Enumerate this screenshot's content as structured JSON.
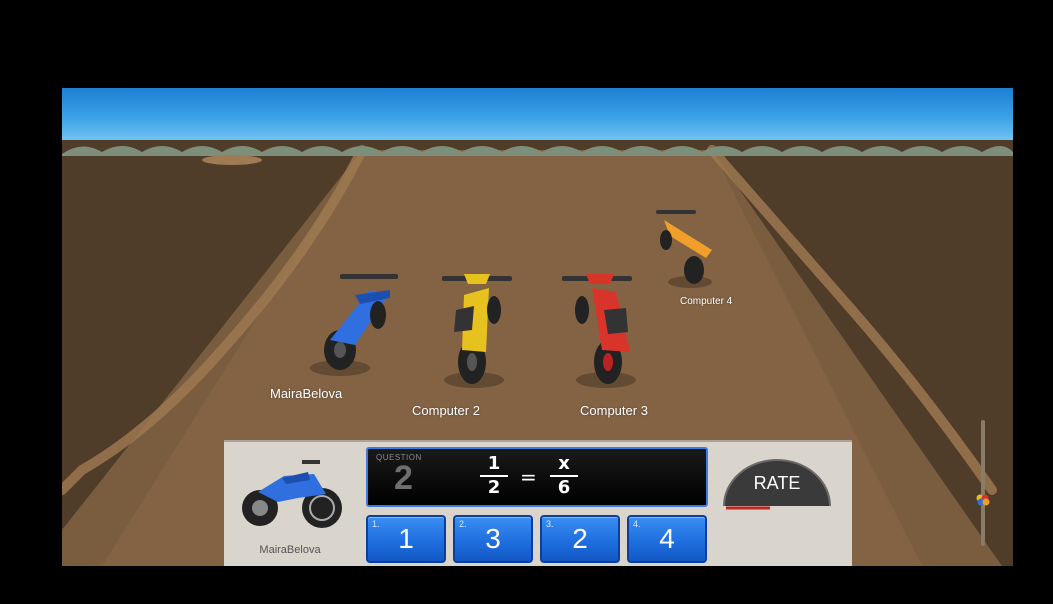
{
  "racers": [
    {
      "name": "MairaBelova",
      "color": "#2f6fe0"
    },
    {
      "name": "Computer 2",
      "color": "#e7c21f"
    },
    {
      "name": "Computer 3",
      "color": "#d8342a"
    },
    {
      "name": "Computer 4",
      "color": "#f0a02a"
    }
  ],
  "hud": {
    "player_name": "MairaBelova",
    "question_label": "QUESTION",
    "question_number": "2",
    "equation": {
      "left_numerator": "1",
      "left_denominator": "2",
      "operator": "=",
      "right_numerator": "x",
      "right_denominator": "6"
    },
    "answers": [
      {
        "index": "1.",
        "value": "1"
      },
      {
        "index": "2.",
        "value": "3"
      },
      {
        "index": "3.",
        "value": "2"
      },
      {
        "index": "4.",
        "value": "4"
      }
    ],
    "rate_label": "RATE"
  },
  "colors": {
    "sky": "#3aa1e6",
    "dirt": "#5a4530",
    "answer_button": "#1f6fe0",
    "hud_bg": "#d9d4cc"
  }
}
